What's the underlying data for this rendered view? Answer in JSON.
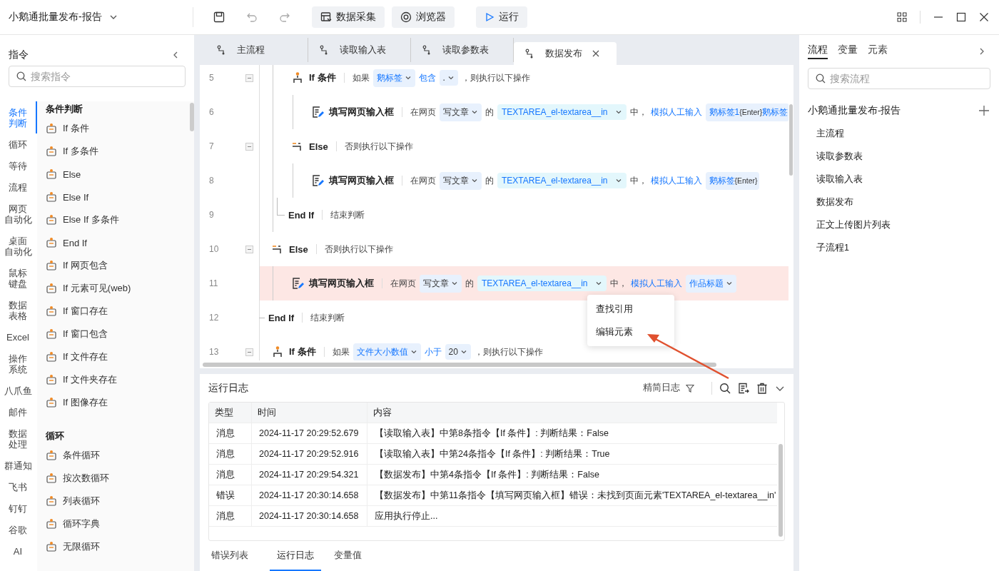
{
  "app": {
    "title": "小鹅通批量发布-报告"
  },
  "toolbar": {
    "buttons": [
      {
        "label": "数据采集",
        "kind": "collect"
      },
      {
        "label": "浏览器",
        "kind": "browser"
      },
      {
        "label": "运行",
        "kind": "run"
      }
    ]
  },
  "left_panel": {
    "title": "指令",
    "search": {
      "placeholder": "搜索指令"
    },
    "categories": [
      {
        "lines": [
          "条件",
          "判断"
        ],
        "selected": true
      },
      {
        "lines": [
          "循环"
        ],
        "selected": false
      },
      {
        "lines": [
          "等待"
        ],
        "selected": false
      },
      {
        "lines": [
          "流程"
        ],
        "selected": false
      },
      {
        "lines": [
          "网页",
          "自动化"
        ],
        "selected": false
      },
      {
        "lines": [
          "桌面",
          "自动化"
        ],
        "selected": false
      },
      {
        "lines": [
          "鼠标",
          "键盘"
        ],
        "selected": false
      },
      {
        "lines": [
          "数据",
          "表格"
        ],
        "selected": false
      },
      {
        "lines": [
          "Excel"
        ],
        "selected": false
      },
      {
        "lines": [
          "操作",
          "系统"
        ],
        "selected": false
      },
      {
        "lines": [
          "八爪鱼"
        ],
        "selected": false
      },
      {
        "lines": [
          "邮件"
        ],
        "selected": false
      },
      {
        "lines": [
          "数据",
          "处理"
        ],
        "selected": false
      },
      {
        "lines": [
          "群通知"
        ],
        "selected": false
      },
      {
        "lines": [
          "飞书"
        ],
        "selected": false
      },
      {
        "lines": [
          "钉钉"
        ],
        "selected": false
      },
      {
        "lines": [
          "谷歌"
        ],
        "selected": false
      },
      {
        "lines": [
          "AI"
        ],
        "selected": false
      }
    ],
    "sections": [
      {
        "title": "条件判断",
        "items": [
          "If 条件",
          "If 多条件",
          "Else",
          "Else If",
          "Else If 多条件",
          "End If",
          "If 网页包含",
          "If 元素可见(web)",
          "If 窗口存在",
          "If 窗口包含",
          "If 文件存在",
          "If 文件夹存在",
          "If 图像存在"
        ]
      },
      {
        "title": "循环",
        "items": [
          "条件循环",
          "按次数循环",
          "列表循环",
          "循环字典",
          "无限循环"
        ]
      }
    ]
  },
  "editor": {
    "tabs": [
      {
        "label": "主流程",
        "selected": false
      },
      {
        "label": "读取输入表",
        "selected": false
      },
      {
        "label": "读取参数表",
        "selected": false
      },
      {
        "label": "数据发布",
        "selected": true
      }
    ],
    "lines": [
      {
        "children": [
          {
            "number": "5",
            "kind": "if",
            "expanded": true,
            "name": "If 条件",
            "parts": [
              {
                "kind": "text",
                "text": "如果"
              },
              {
                "kind": "select",
                "text": "鹅标签",
                "variable": true
              },
              {
                "kind": "keyword",
                "text": "包含"
              },
              {
                "kind": "select",
                "text": ".",
                "variable": false
              },
              {
                "kind": "text",
                "text": "，则执行以下操作"
              }
            ],
            "children": [
              {
                "number": "6",
                "kind": "fill",
                "name": "填写网页输入框",
                "parts": [
                  {
                    "kind": "text",
                    "text": "在网页"
                  },
                  {
                    "kind": "select",
                    "text": "写文章",
                    "variable": false
                  },
                  {
                    "kind": "text",
                    "text": "的"
                  },
                  {
                    "kind": "element",
                    "text": "TEXTAREA_el-textarea__in"
                  },
                  {
                    "kind": "text",
                    "text": "中，"
                  },
                  {
                    "kind": "keyword",
                    "text": "模拟人工输入"
                  },
                  {
                    "kind": "value",
                    "segments": [
                      {
                        "text": "鹅标签1",
                        "variable": true
                      },
                      {
                        "text": "{Enter}",
                        "variable": false
                      },
                      {
                        "text": "鹅标签",
                        "variable": true
                      }
                    ]
                  }
                ]
              }
            ]
          },
          {
            "number": "7",
            "kind": "else",
            "expanded": true,
            "name": "Else",
            "parts": [
              {
                "kind": "text",
                "text": "否则执行以下操作"
              }
            ],
            "children": [
              {
                "number": "8",
                "kind": "fill",
                "name": "填写网页输入框",
                "parts": [
                  {
                    "kind": "text",
                    "text": "在网页"
                  },
                  {
                    "kind": "select",
                    "text": "写文章",
                    "variable": false
                  },
                  {
                    "kind": "text",
                    "text": "的"
                  },
                  {
                    "kind": "element",
                    "text": "TEXTAREA_el-textarea__in"
                  },
                  {
                    "kind": "text",
                    "text": "中，"
                  },
                  {
                    "kind": "keyword",
                    "text": "模拟人工输入"
                  },
                  {
                    "kind": "value",
                    "segments": [
                      {
                        "text": "鹅标签",
                        "variable": true
                      },
                      {
                        "text": "{Enter}",
                        "variable": false
                      }
                    ]
                  }
                ]
              }
            ]
          },
          {
            "number": "9",
            "kind": "endif",
            "name": "End If",
            "parts": [
              {
                "kind": "text",
                "text": "结束判断"
              }
            ]
          }
        ]
      },
      {
        "number": "10",
        "kind": "else",
        "expanded": true,
        "name": "Else",
        "parts": [
          {
            "kind": "text",
            "text": "否则执行以下操作"
          }
        ],
        "children": [
          {
            "number": "11",
            "kind": "fill",
            "error": true,
            "name": "填写网页输入框",
            "parts": [
              {
                "kind": "text",
                "text": "在网页"
              },
              {
                "kind": "select",
                "text": "写文章",
                "variable": false
              },
              {
                "kind": "text",
                "text": "的"
              },
              {
                "kind": "element",
                "text": "TEXTAREA_el-textarea__in"
              },
              {
                "kind": "text",
                "text": "中，"
              },
              {
                "kind": "keyword",
                "text": "模拟人工输入"
              },
              {
                "kind": "select",
                "text": "作品标题",
                "variable": true
              }
            ]
          }
        ]
      },
      {
        "number": "12",
        "kind": "endif",
        "name": "End If",
        "parts": [
          {
            "kind": "text",
            "text": "结束判断"
          }
        ]
      },
      {
        "number": "13",
        "kind": "if",
        "expanded": true,
        "name": "If 条件",
        "parts": [
          {
            "kind": "text",
            "text": "如果"
          },
          {
            "kind": "select",
            "text": "文件大小数值",
            "variable": true
          },
          {
            "kind": "keyword",
            "text": "小于"
          },
          {
            "kind": "select",
            "text": "20",
            "variable": false
          },
          {
            "kind": "text",
            "text": "，则执行以下操作"
          }
        ]
      }
    ],
    "context_menu": [
      "查找引用",
      "编辑元素"
    ]
  },
  "log": {
    "title": "运行日志",
    "filter": "精简日志",
    "columns": [
      "类型",
      "时间",
      "内容"
    ],
    "rows": [
      {
        "type": "消息",
        "time": "2024-11-17 20:29:52.679",
        "content": "【读取输入表】中第8条指令【If 条件】: 判断结果：False"
      },
      {
        "type": "消息",
        "time": "2024-11-17 20:29:52.916",
        "content": "【读取输入表】中第24条指令【If 条件】: 判断结果：True"
      },
      {
        "type": "消息",
        "time": "2024-11-17 20:29:54.321",
        "content": "【数据发布】中第4条指令【If 条件】: 判断结果：False"
      },
      {
        "type": "错误",
        "time": "2024-11-17 20:30:14.658",
        "content": "【数据发布】中第11条指令【填写网页输入框】错误：未找到页面元素'TEXTAREA_el-textarea__in'"
      },
      {
        "type": "消息",
        "time": "2024-11-17 20:30:14.658",
        "content": "应用执行停止..."
      }
    ],
    "tabs": [
      {
        "label": "错误列表",
        "selected": false
      },
      {
        "label": "运行日志",
        "selected": true
      },
      {
        "label": "变量值",
        "selected": false
      }
    ]
  },
  "right_panel": {
    "tabs": [
      {
        "label": "流程",
        "selected": true
      },
      {
        "label": "变量",
        "selected": false
      },
      {
        "label": "元素",
        "selected": false
      }
    ],
    "search": {
      "placeholder": "搜索流程"
    },
    "project": "小鹅通批量发布-报告",
    "flows": [
      "主流程",
      "读取参数表",
      "读取输入表",
      "数据发布",
      "正文上传图片列表",
      "子流程1"
    ]
  }
}
